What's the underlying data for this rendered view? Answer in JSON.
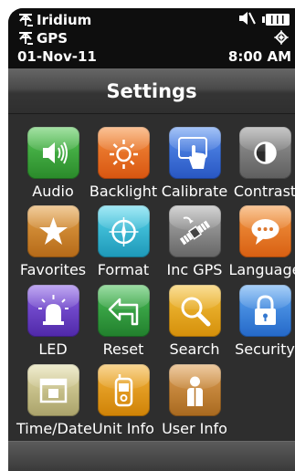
{
  "status": {
    "satellite_label": "Iridium",
    "gps_label": "GPS",
    "date": "01-Nov-11",
    "time": "8:00 AM",
    "icons": [
      "antenna-icon",
      "antenna-icon",
      "mute-icon",
      "battery-icon",
      "gps-fix-icon"
    ]
  },
  "title": "Settings",
  "tiles": [
    {
      "label": "Audio",
      "icon": "speaker-icon",
      "color": "#3aa83a"
    },
    {
      "label": "Backlight",
      "icon": "sun-icon",
      "color": "#e7661c"
    },
    {
      "label": "Calibrate",
      "icon": "touch-hand-icon",
      "color": "#3a6fd8"
    },
    {
      "label": "Contrast",
      "icon": "contrast-icon",
      "color": "#7a7a7a"
    },
    {
      "label": "Favorites",
      "icon": "star-icon",
      "color": "#d4862a"
    },
    {
      "label": "Format",
      "icon": "compass-icon",
      "color": "#2fb8d3"
    },
    {
      "label": "Inc GPS",
      "icon": "satellite-icon",
      "color": "#8a8a8a"
    },
    {
      "label": "Language",
      "icon": "speech-bubble-icon",
      "color": "#e8751d"
    },
    {
      "label": "LED",
      "icon": "led-light-icon",
      "color": "#6a3ec4"
    },
    {
      "label": "Reset",
      "icon": "reset-arrow-icon",
      "color": "#2f9c3a"
    },
    {
      "label": "Search",
      "icon": "magnifier-icon",
      "color": "#e5a816"
    },
    {
      "label": "Security",
      "icon": "padlock-icon",
      "color": "#3a8ae0"
    },
    {
      "label": "Time/Date",
      "icon": "calendar-icon",
      "color": "#c9c08a"
    },
    {
      "label": "Unit Info",
      "icon": "handheld-device-icon",
      "color": "#e59a16"
    },
    {
      "label": "User Info",
      "icon": "person-icon",
      "color": "#c98a35"
    }
  ]
}
